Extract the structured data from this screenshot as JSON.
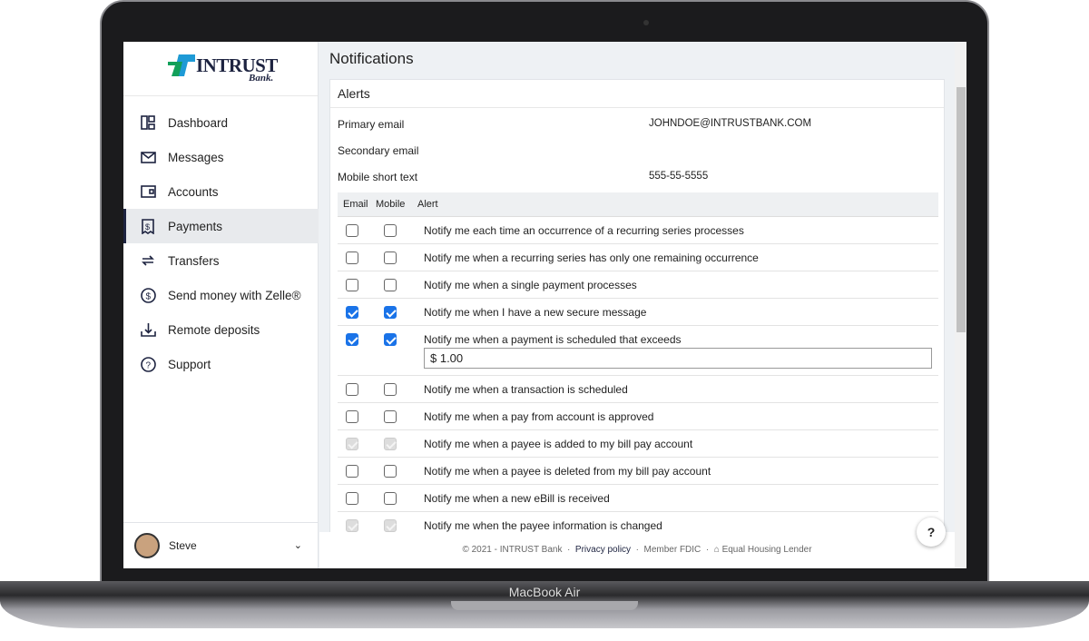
{
  "device": {
    "label": "MacBook Air"
  },
  "logo": {
    "name": "INTRUST",
    "sub": "Bank."
  },
  "sidebar": {
    "items": [
      {
        "label": "Dashboard",
        "icon": "dashboard-icon"
      },
      {
        "label": "Messages",
        "icon": "envelope-icon"
      },
      {
        "label": "Accounts",
        "icon": "wallet-icon"
      },
      {
        "label": "Payments",
        "icon": "receipt-dollar-icon",
        "active": true
      },
      {
        "label": "Transfers",
        "icon": "transfer-arrows-icon"
      },
      {
        "label": "Send money with Zelle®",
        "icon": "dollar-circle-icon"
      },
      {
        "label": "Remote deposits",
        "icon": "download-tray-icon"
      },
      {
        "label": "Support",
        "icon": "question-circle-icon"
      }
    ],
    "user": "Steve"
  },
  "page": {
    "title": "Notifications"
  },
  "alerts": {
    "title": "Alerts",
    "contacts": [
      {
        "label": "Primary email",
        "value": "JOHNDOE@INTRUSTBANK.COM"
      },
      {
        "label": "Secondary email",
        "value": ""
      },
      {
        "label": "Mobile short text",
        "value": "555-55-5555"
      }
    ],
    "headers": [
      "Email",
      "Mobile",
      "Alert"
    ],
    "rows": [
      {
        "text": "Notify me each time an occurrence of a recurring series processes",
        "email": "off",
        "mobile": "off"
      },
      {
        "text": "Notify me when a recurring series has only one remaining occurrence",
        "email": "off",
        "mobile": "off"
      },
      {
        "text": "Notify me when a single payment processes",
        "email": "off",
        "mobile": "off"
      },
      {
        "text": "Notify me when I have a new secure message",
        "email": "on",
        "mobile": "on"
      },
      {
        "text": "Notify me when a payment is scheduled that exceeds",
        "email": "on",
        "mobile": "on",
        "amount": "$ 1.00"
      },
      {
        "text": "Notify me when a transaction is scheduled",
        "email": "off",
        "mobile": "off"
      },
      {
        "text": "Notify me when a pay from account is approved",
        "email": "off",
        "mobile": "off"
      },
      {
        "text": "Notify me when a payee is added to my bill pay account",
        "email": "dis",
        "mobile": "dis"
      },
      {
        "text": "Notify me when a payee is deleted from my bill pay account",
        "email": "off",
        "mobile": "off"
      },
      {
        "text": "Notify me when a new eBill is received",
        "email": "off",
        "mobile": "off"
      },
      {
        "text": "Notify me when the payee information is changed",
        "email": "dis",
        "mobile": "dis"
      }
    ]
  },
  "footer": {
    "copyright": "© 2021 - INTRUST Bank",
    "privacy": "Privacy policy",
    "fdic": "Member FDIC",
    "housing": "Equal Housing Lender"
  },
  "help": "?",
  "colors": {
    "accent": "#1a73e8",
    "brand_navy": "#1d2340",
    "brand_green": "#12a05a",
    "brand_blue": "#1e9ad6"
  }
}
